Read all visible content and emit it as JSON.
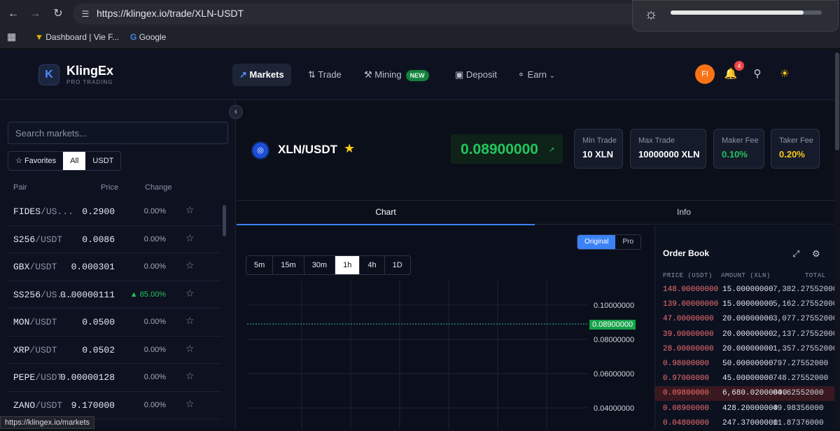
{
  "browser": {
    "url": "https://klingex.io/trade/XLN-USDT",
    "bookmarks": [
      "Dashboard | Vie F...",
      "Google"
    ],
    "brightness_level": 0.88,
    "status_url": "https://klingex.io/markets"
  },
  "header": {
    "logo_letter": "K",
    "brand": "KlingEx",
    "brand_sub": "PRO TRADING",
    "menu": {
      "markets": "Markets",
      "trade": "Trade",
      "mining": "Mining",
      "mining_badge": "NEW",
      "deposit": "Deposit",
      "earn": "Earn"
    },
    "avatar_initials": "FI",
    "notification_count": "4"
  },
  "sidebar": {
    "search_placeholder": "Search markets...",
    "filters": {
      "favorites": "Favorites",
      "all": "All",
      "usdt": "USDT"
    },
    "columns": {
      "pair": "Pair",
      "price": "Price",
      "change": "Change"
    },
    "markets": [
      {
        "base": "FIDES",
        "quote": "/US...",
        "price": "0.2900",
        "change": "0.00%",
        "up": false
      },
      {
        "base": "S256",
        "quote": "/USDT",
        "price": "0.0086",
        "change": "0.00%",
        "up": false
      },
      {
        "base": "GBX",
        "quote": "/USDT",
        "price": "0.000301",
        "change": "0.00%",
        "up": false
      },
      {
        "base": "SS256",
        "quote": "/US...",
        "price": "0.00000111",
        "change": "▲ 85.00%",
        "up": true
      },
      {
        "base": "MON",
        "quote": "/USDT",
        "price": "0.0500",
        "change": "0.00%",
        "up": false
      },
      {
        "base": "XRP",
        "quote": "/USDT",
        "price": "0.0502",
        "change": "0.00%",
        "up": false
      },
      {
        "base": "PEPE",
        "quote": "/USDT",
        "price": "0.00000128",
        "change": "0.00%",
        "up": false
      },
      {
        "base": "ZANO",
        "quote": "/USDT",
        "price": "9.170000",
        "change": "0.00%",
        "up": false
      }
    ]
  },
  "pair": {
    "title": "XLN/USDT",
    "last_price": "0.08900000",
    "stats": [
      {
        "label": "Min Trade",
        "value": "10 XLN",
        "color": "#ffffff"
      },
      {
        "label": "Max Trade",
        "value": "10000000 XLN",
        "color": "#ffffff"
      },
      {
        "label": "Maker Fee",
        "value": "0.10%",
        "color": "#22c55e"
      },
      {
        "label": "Taker Fee",
        "value": "0.20%",
        "color": "#facc15"
      }
    ]
  },
  "tabs": {
    "chart": "Chart",
    "info": "Info"
  },
  "chart": {
    "mode_original": "Original",
    "mode_pro": "Pro",
    "intervals": [
      "5m",
      "15m",
      "30m",
      "1h",
      "4h",
      "1D"
    ],
    "selected_interval": "1h",
    "axis_ticks": [
      "0.10000000",
      "0.08000000",
      "0.06000000",
      "0.04000000"
    ],
    "current_price": "0.08900000"
  },
  "orderbook": {
    "title": "Order Book",
    "columns": {
      "price": "PRICE (USDT)",
      "amount": "AMOUNT (XLN)",
      "total": "TOTAL"
    },
    "rows": [
      {
        "price": "148.00000000",
        "amount": "15.00000000",
        "total": "7,382.27552000",
        "hl": false
      },
      {
        "price": "139.00000000",
        "amount": "15.00000000",
        "total": "5,162.27552000",
        "hl": false
      },
      {
        "price": "47.00000000",
        "amount": "20.00000000",
        "total": "3,077.27552000",
        "hl": false
      },
      {
        "price": "39.00000000",
        "amount": "20.00000000",
        "total": "2,137.27552000",
        "hl": false
      },
      {
        "price": "28.00000000",
        "amount": "20.00000000",
        "total": "1,357.27552000",
        "hl": false
      },
      {
        "price": "0.98000000",
        "amount": "50.00000000",
        "total": "797.27552000",
        "hl": false
      },
      {
        "price": "0.97000000",
        "amount": "45.00000000",
        "total": "748.27552000",
        "hl": false
      },
      {
        "price": "0.09800000",
        "amount": "6,680.02000000",
        "total": "04.62552000",
        "hl": true
      },
      {
        "price": "0.08900000",
        "amount": "428.20000000",
        "total": "49.98356000",
        "hl": false
      },
      {
        "price": "0.04800000",
        "amount": "247.37000000",
        "total": "11.87376000",
        "hl": false
      }
    ]
  }
}
